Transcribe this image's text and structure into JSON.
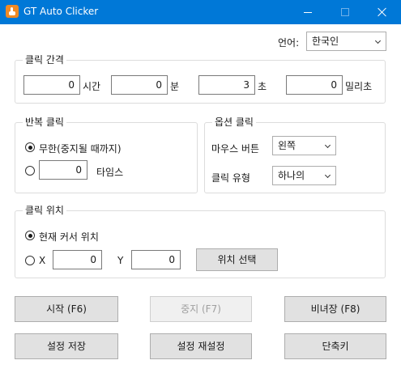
{
  "window": {
    "title": "GT Auto Clicker",
    "app_icon": "hand-pointer-icon",
    "title_bar_color": "#0078d7"
  },
  "language": {
    "label": "언어:",
    "value": "한국인"
  },
  "interval": {
    "title": "클릭 간격",
    "hours_value": "0",
    "hours_label": "시간",
    "minutes_value": "0",
    "minutes_label": "분",
    "seconds_value": "3",
    "seconds_label": "초",
    "millis_value": "0",
    "millis_label": "밀리초"
  },
  "repeat": {
    "title": "반복 클릭",
    "until_stopped_label": "무한(중지될 때까지)",
    "times_value": "0",
    "times_label": "타임스"
  },
  "options": {
    "title": "옵션 클릭",
    "mouse_button_label": "마우스 버튼",
    "mouse_button_value": "왼쪽",
    "click_type_label": "클릭 유형",
    "click_type_value": "하나의"
  },
  "position": {
    "title": "클릭 위치",
    "current_cursor_label": "현재 커서 위치",
    "x_label": "X",
    "x_value": "0",
    "y_label": "Y",
    "y_value": "0",
    "pick_button": "위치 선택"
  },
  "buttons": {
    "start": "시작 (F6)",
    "stop": "중지 (F7)",
    "hide": "비녀장 (F8)",
    "save": "설정 저장",
    "reset": "설정 재설정",
    "shortcuts": "단축키"
  }
}
